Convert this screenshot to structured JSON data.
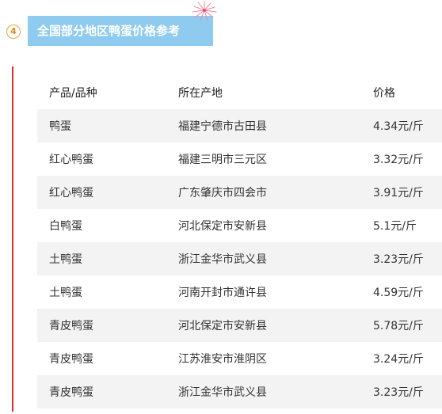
{
  "section": {
    "number": "4",
    "title": "全国部分地区鸭蛋价格参考"
  },
  "table": {
    "headers": [
      "产品/品种",
      "所在产地",
      "价格"
    ],
    "rows": [
      [
        "鸭蛋",
        "福建宁德市古田县",
        "4.34元/斤"
      ],
      [
        "红心鸭蛋",
        "福建三明市三元区",
        "3.32元/斤"
      ],
      [
        "红心鸭蛋",
        "广东肇庆市四会市",
        "3.91元/斤"
      ],
      [
        "白鸭蛋",
        "河北保定市安新县",
        "5.1元/斤"
      ],
      [
        "土鸭蛋",
        "浙江金华市武义县",
        "3.23元/斤"
      ],
      [
        "土鸭蛋",
        "河南开封市通许县",
        "4.59元/斤"
      ],
      [
        "青皮鸭蛋",
        "河北保定市安新县",
        "5.78元/斤"
      ],
      [
        "青皮鸭蛋",
        "江苏淮安市淮阴区",
        "3.24元/斤"
      ],
      [
        "青皮鸭蛋",
        "浙江金华市武义县",
        "3.23元/斤"
      ]
    ]
  },
  "colors": {
    "title_bg": "#8fcbee",
    "accent_line": "#e02b2b",
    "badge": "#e8a23a",
    "row_stripe": "#f3f3f3"
  }
}
